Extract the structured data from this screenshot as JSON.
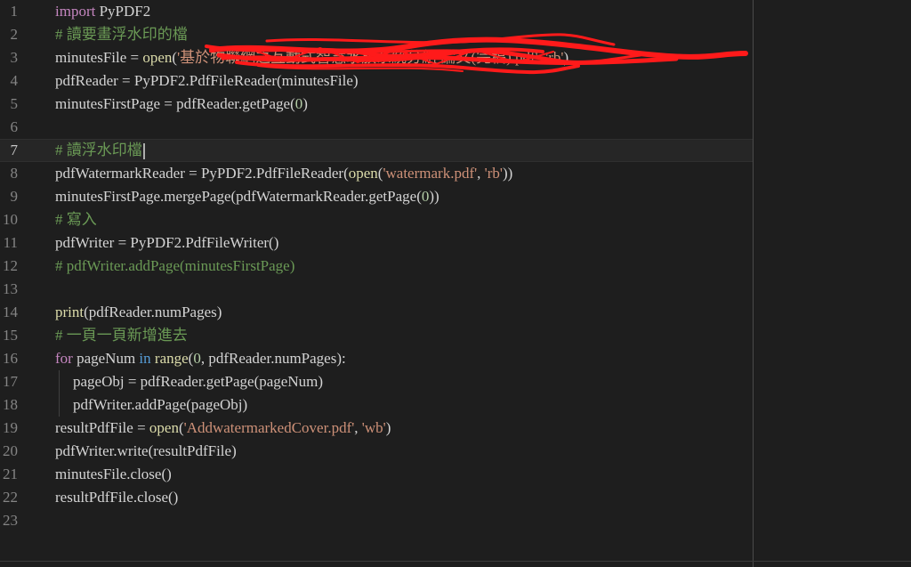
{
  "editor": {
    "colors": {
      "background": "#1e1e1e",
      "keyword_import": "#c586c0",
      "keyword": "#569cd6",
      "function": "#dcdcaa",
      "string": "#ce9178",
      "number": "#b5cea8",
      "comment": "#6a9955",
      "redaction": "#ff1a1a"
    },
    "current_line": 7,
    "redacted_line": 3,
    "lines": [
      {
        "n": "1",
        "t": [
          {
            "k": "kw-import",
            "v": "import"
          },
          {
            "k": "id",
            "v": " PyPDF2"
          }
        ]
      },
      {
        "n": "2",
        "t": [
          {
            "k": "cmt",
            "v": "# 讀要畫浮水印的檔"
          }
        ]
      },
      {
        "n": "3",
        "t": [
          {
            "k": "id",
            "v": "minutesFile = "
          },
          {
            "k": "fn",
            "v": "open"
          },
          {
            "k": "id",
            "v": "("
          },
          {
            "k": "str",
            "v": "'基於物聯網之互動式智慧水族系統分組 論文(完稿).pdf'"
          },
          {
            "k": "id",
            "v": ", "
          },
          {
            "k": "str",
            "v": "'rb'"
          },
          {
            "k": "id",
            "v": ")"
          }
        ]
      },
      {
        "n": "4",
        "t": [
          {
            "k": "id",
            "v": "pdfReader = PyPDF2.PdfFileReader(minutesFile)"
          }
        ]
      },
      {
        "n": "5",
        "t": [
          {
            "k": "id",
            "v": "minutesFirstPage = pdfReader.getPage("
          },
          {
            "k": "num",
            "v": "0"
          },
          {
            "k": "id",
            "v": ")"
          }
        ]
      },
      {
        "n": "6",
        "t": []
      },
      {
        "n": "7",
        "t": [
          {
            "k": "cmt",
            "v": "# 讀浮水印檔"
          }
        ]
      },
      {
        "n": "8",
        "t": [
          {
            "k": "id",
            "v": "pdfWatermarkReader = PyPDF2.PdfFileReader("
          },
          {
            "k": "fn",
            "v": "open"
          },
          {
            "k": "id",
            "v": "("
          },
          {
            "k": "str",
            "v": "'watermark.pdf'"
          },
          {
            "k": "id",
            "v": ", "
          },
          {
            "k": "str",
            "v": "'rb'"
          },
          {
            "k": "id",
            "v": "))"
          }
        ]
      },
      {
        "n": "9",
        "t": [
          {
            "k": "id",
            "v": "minutesFirstPage.mergePage(pdfWatermarkReader.getPage("
          },
          {
            "k": "num",
            "v": "0"
          },
          {
            "k": "id",
            "v": "))"
          }
        ]
      },
      {
        "n": "10",
        "t": [
          {
            "k": "cmt",
            "v": "# 寫入"
          }
        ]
      },
      {
        "n": "11",
        "t": [
          {
            "k": "id",
            "v": "pdfWriter = PyPDF2.PdfFileWriter()"
          }
        ]
      },
      {
        "n": "12",
        "t": [
          {
            "k": "cmt",
            "v": "# pdfWriter.addPage(minutesFirstPage)"
          }
        ]
      },
      {
        "n": "13",
        "t": []
      },
      {
        "n": "14",
        "t": [
          {
            "k": "fn",
            "v": "print"
          },
          {
            "k": "id",
            "v": "(pdfReader.numPages)"
          }
        ]
      },
      {
        "n": "15",
        "t": [
          {
            "k": "cmt",
            "v": "# 一頁一頁新增進去"
          }
        ]
      },
      {
        "n": "16",
        "t": [
          {
            "k": "kw-ctrl",
            "v": "for"
          },
          {
            "k": "id",
            "v": " pageNum "
          },
          {
            "k": "kw",
            "v": "in"
          },
          {
            "k": "id",
            "v": " "
          },
          {
            "k": "fn",
            "v": "range"
          },
          {
            "k": "id",
            "v": "("
          },
          {
            "k": "num",
            "v": "0"
          },
          {
            "k": "id",
            "v": ", pdfReader.numPages):"
          }
        ]
      },
      {
        "n": "17",
        "indent": true,
        "t": [
          {
            "k": "id",
            "v": "pageObj = pdfReader.getPage(pageNum)"
          }
        ]
      },
      {
        "n": "18",
        "indent": true,
        "t": [
          {
            "k": "id",
            "v": "pdfWriter.addPage(pageObj)"
          }
        ]
      },
      {
        "n": "19",
        "t": [
          {
            "k": "id",
            "v": "resultPdfFile = "
          },
          {
            "k": "fn",
            "v": "open"
          },
          {
            "k": "id",
            "v": "("
          },
          {
            "k": "str",
            "v": "'AddwatermarkedCover.pdf'"
          },
          {
            "k": "id",
            "v": ", "
          },
          {
            "k": "str",
            "v": "'wb'"
          },
          {
            "k": "id",
            "v": ")"
          }
        ]
      },
      {
        "n": "20",
        "t": [
          {
            "k": "id",
            "v": "pdfWriter.write(resultPdfFile)"
          }
        ]
      },
      {
        "n": "21",
        "t": [
          {
            "k": "id",
            "v": "minutesFile.close()"
          }
        ]
      },
      {
        "n": "22",
        "t": [
          {
            "k": "id",
            "v": "resultPdfFile.close()"
          }
        ]
      },
      {
        "n": "23",
        "t": []
      }
    ]
  }
}
